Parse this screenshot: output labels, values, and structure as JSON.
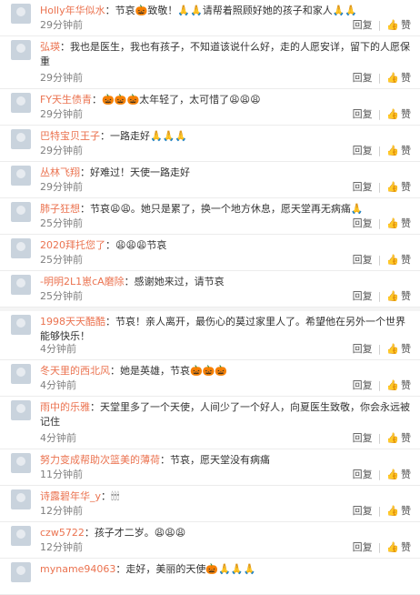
{
  "actions": {
    "reply_label": "回复",
    "like_label": "赞",
    "divider": "|",
    "like_icon": "thumbs-up-icon"
  },
  "comments": [
    {
      "user": "Holly年华似水",
      "text": "节哀🎃致敬！🙏🙏请帮着照顾好她的孩子和家人🙏🙏",
      "time": "29分钟前"
    },
    {
      "user": "弘瑛",
      "text": "我也是医生，我也有孩子，不知道该说什么好，走的人愿安详，留下的人愿保重",
      "time": "29分钟前"
    },
    {
      "user": "FY天生债青",
      "text": "🎃🎃🎃太年轻了，太可惜了😩😩😩",
      "time": "29分钟前"
    },
    {
      "user": "巴特宝贝王子",
      "text": "一路走好🙏🙏🙏",
      "time": "29分钟前"
    },
    {
      "user": "丛林飞翔",
      "text": "好难过！天使一路走好",
      "time": "29分钟前"
    },
    {
      "user": "肺子狂想",
      "text": "节哀😩😩。她只是累了，换一个地方休息，愿天堂再无病痛🙏",
      "time": "25分钟前"
    },
    {
      "user": "2020拜托您了",
      "text": "😩😩😩节哀",
      "time": "25分钟前"
    },
    {
      "user": "-明明2L1崽cA磨除",
      "text": "感谢她来过，请节哀",
      "time": "25分钟前"
    },
    {
      "user": "1998天天酷酷",
      "text": "节哀！亲人离开，最伤心的莫过家里人了。希望他在另外一个世界能够快乐！",
      "time": "4分钟前"
    },
    {
      "user": "冬天里的西北风",
      "text": "她是英雄，节哀🎃🎃🎃",
      "time": "4分钟前"
    },
    {
      "user": "雨中的乐雅",
      "text": "天堂里多了一个天使，人间少了一个好人，向夏医生致敬，你会永远被记住",
      "time": "4分钟前"
    },
    {
      "user": "努力变成帮助次篮美的薄荷",
      "text": "节哀，愿天堂没有病痛",
      "time": "11分钟前"
    },
    {
      "user": "诗露碧年华_y",
      "text": "🕯🕯🕯",
      "time": "12分钟前"
    },
    {
      "user": "czw5722",
      "text": "孩子才二岁。😩😩😩",
      "time": "12分钟前"
    },
    {
      "user": "myname94063",
      "text": "走好，美丽的天使🎃🙏🙏🙏",
      "time": ""
    }
  ]
}
